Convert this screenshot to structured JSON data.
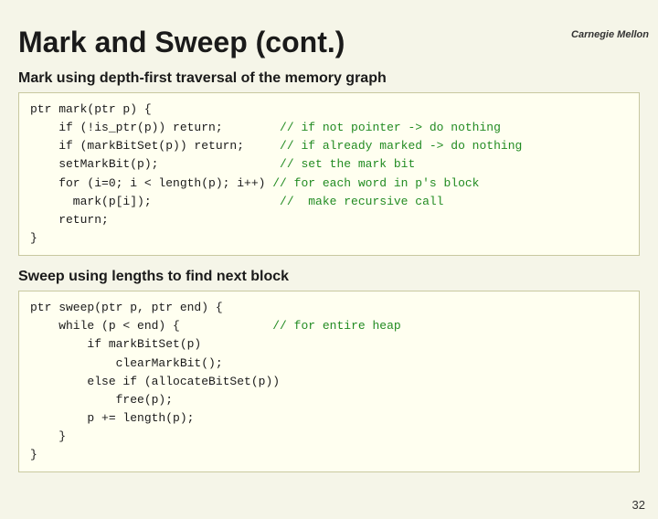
{
  "header": {
    "logo": "Carnegie Mellon"
  },
  "title": "Mark and Sweep (cont.)",
  "section1": {
    "label": "Mark using depth-first traversal of the memory graph",
    "code_lines": [
      {
        "code": "ptr mark(ptr p) {",
        "comment": ""
      },
      {
        "code": "    if (!is_ptr(p)) return;",
        "comment": "  // if not pointer -> do nothing"
      },
      {
        "code": "    if (markBitSet(p)) return;",
        "comment": " // if already marked -> do nothing"
      },
      {
        "code": "    setMarkBit(p);",
        "comment": "           // set the mark bit"
      },
      {
        "code": "    for (i=0; i < length(p); i++)",
        "comment": " // for each word in p's block"
      },
      {
        "code": "      mark(p[i]);",
        "comment": "           //  make recursive call"
      },
      {
        "code": "    return;",
        "comment": ""
      },
      {
        "code": "}",
        "comment": ""
      }
    ]
  },
  "section2": {
    "label": "Sweep using lengths to find next block",
    "code_lines": [
      {
        "code": "ptr sweep(ptr p, ptr end) {",
        "comment": ""
      },
      {
        "code": "    while (p < end) {",
        "comment": "          // for entire heap"
      },
      {
        "code": "        if markBitSet(p)",
        "comment": ""
      },
      {
        "code": "            clearMarkBit();",
        "comment": ""
      },
      {
        "code": "        else if (allocateBitSet(p))",
        "comment": ""
      },
      {
        "code": "            free(p);",
        "comment": ""
      },
      {
        "code": "        p += length(p);",
        "comment": ""
      },
      {
        "code": "    }",
        "comment": ""
      },
      {
        "code": "}",
        "comment": ""
      }
    ]
  },
  "page_number": "32"
}
